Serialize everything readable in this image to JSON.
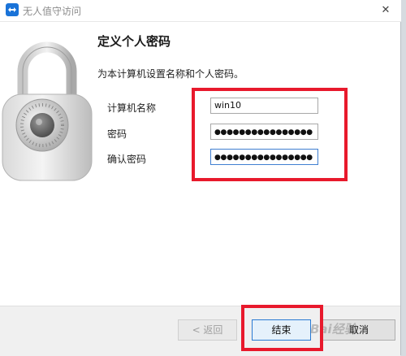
{
  "window": {
    "title": "无人值守访问",
    "close_glyph": "✕"
  },
  "panel": {
    "heading": "定义个人密码",
    "description": "为本计算机设置名称和个人密码。"
  },
  "form": {
    "computer_name_label": "计算机名称",
    "computer_name_value": "win10",
    "password_label": "密码",
    "password_value": "●●●●●●●●●●●●●●●●",
    "confirm_label": "确认密码",
    "confirm_value": "●●●●●●●●●●●●●●●●"
  },
  "buttons": {
    "back": "< 返回",
    "finish": "结束",
    "cancel": "取消"
  },
  "watermark": "Bai经验",
  "colors": {
    "highlight": "#e8192c",
    "accent": "#2a7ad2"
  },
  "icons": {
    "app": "teamviewer-icon",
    "hero": "padlock-icon"
  }
}
